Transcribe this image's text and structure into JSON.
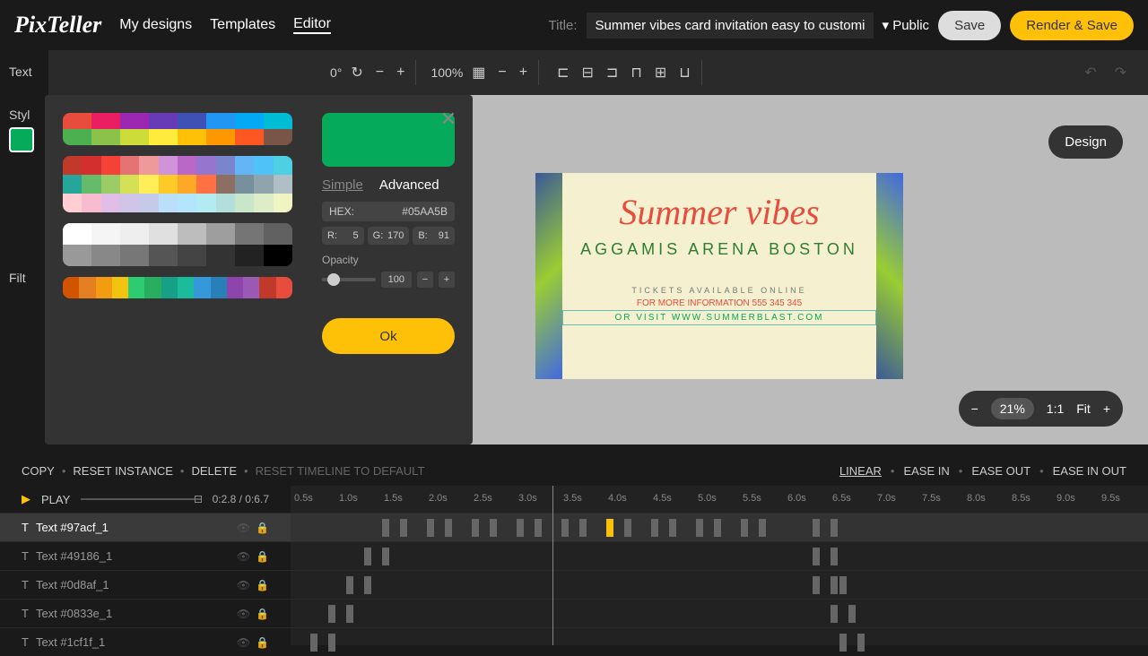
{
  "header": {
    "logo": "PixTeller",
    "nav": [
      "My designs",
      "Templates",
      "Editor"
    ],
    "title_label": "Title:",
    "title_value": "Summer vibes card invitation easy to customiz",
    "visibility": "Public",
    "save": "Save",
    "render": "Render & Save"
  },
  "toolbar": {
    "rotation": "0°",
    "zoom": "100%"
  },
  "sidebar": {
    "text_label": "Text",
    "style_label": "Styl",
    "filter_label": "Filt"
  },
  "color_picker": {
    "tabs": {
      "simple": "Simple",
      "advanced": "Advanced"
    },
    "hex_label": "HEX:",
    "hex_value": "#05AA5B",
    "r_label": "R:",
    "r_value": "5",
    "g_label": "G:",
    "g_value": "170",
    "b_label": "B:",
    "b_value": "91",
    "opacity_label": "Opacity",
    "opacity_value": "100",
    "ok": "Ok",
    "preview_color": "#05aa5b",
    "palette1": [
      [
        "#e74c3c",
        "#e91e63",
        "#9c27b0",
        "#673ab7",
        "#3f51b5",
        "#2196f3",
        "#03a9f4",
        "#00bcd4"
      ],
      [
        "#4caf50",
        "#8bc34a",
        "#cddc39",
        "#ffeb3b",
        "#ffc107",
        "#ff9800",
        "#ff5722",
        "#795548"
      ]
    ],
    "palette2": [
      [
        "#c0392b",
        "#d32f2f",
        "#f44336",
        "#e57373",
        "#ef9a9a",
        "#ce93d8",
        "#ba68c8",
        "#9575cd",
        "#7986cb",
        "#64b5f6",
        "#4fc3f7",
        "#4dd0e1"
      ],
      [
        "#26a69a",
        "#66bb6a",
        "#9ccc65",
        "#d4e157",
        "#ffee58",
        "#ffca28",
        "#ffa726",
        "#ff7043",
        "#8d6e63",
        "#78909c",
        "#90a4ae",
        "#b0bec5"
      ],
      [
        "#ffcdd2",
        "#f8bbd0",
        "#e1bee7",
        "#d1c4e9",
        "#c5cae9",
        "#bbdefb",
        "#b3e5fc",
        "#b2ebf2",
        "#b2dfdb",
        "#c8e6c9",
        "#dcedc8",
        "#f0f4c3"
      ]
    ],
    "palette3": [
      [
        "#ffffff",
        "#f5f5f5",
        "#eeeeee",
        "#e0e0e0",
        "#bdbdbd",
        "#9e9e9e",
        "#757575",
        "#616161"
      ],
      [
        "#999999",
        "#888888",
        "#777777",
        "#555555",
        "#444444",
        "#333333",
        "#222222",
        "#000000"
      ]
    ],
    "palette4": [
      [
        "#d35400",
        "#e67e22",
        "#f39c12",
        "#f1c40f",
        "#2ecc71",
        "#27ae60",
        "#16a085",
        "#1abc9c",
        "#3498db",
        "#2980b9",
        "#8e44ad",
        "#9b59b6",
        "#c0392b",
        "#e74c3c"
      ]
    ]
  },
  "canvas": {
    "title": "Summer vibes",
    "subtitle": "AGGAMIS ARENA BOSTON",
    "line1": "TICKETS AVAILABLE ONLINE",
    "line2": "FOR MORE INFORMATION 555 345 345",
    "line3": "OR VISIT WWW.SUMMERBLAST.COM",
    "design_btn": "Design"
  },
  "zoom_ctrl": {
    "value": "21%",
    "ratio": "1:1",
    "fit": "Fit"
  },
  "tl_actions": {
    "copy": "COPY",
    "reset_instance": "RESET INSTANCE",
    "delete": "DELETE",
    "reset_tl": "RESET TIMELINE TO DEFAULT",
    "linear": "LINEAR",
    "ease_in": "EASE IN",
    "ease_out": "EASE OUT",
    "ease_in_out": "EASE IN OUT"
  },
  "timeline": {
    "play": "PLAY",
    "time": "0:2.8 / 0:6.7",
    "ticks": [
      "0.5s",
      "1.0s",
      "1.5s",
      "2.0s",
      "2.5s",
      "3.0s",
      "3.5s",
      "4.0s",
      "4.5s",
      "5.0s",
      "5.5s",
      "6.0s",
      "6.5s",
      "7.0s",
      "7.5s",
      "8.0s",
      "8.5s",
      "9.0s",
      "9.5s"
    ],
    "layers": [
      "Text #97acf_1",
      "Text #49186_1",
      "Text #0d8af_1",
      "Text #0833e_1",
      "Text #1cf1f_1"
    ],
    "keyframes": [
      [
        102,
        122,
        152,
        172,
        202,
        222,
        252,
        272,
        302,
        322,
        352,
        372,
        402,
        422,
        452,
        472,
        502,
        522,
        582,
        602
      ],
      [
        82,
        102,
        582,
        602
      ],
      [
        62,
        82,
        582,
        602,
        612
      ],
      [
        42,
        62,
        602,
        622
      ],
      [
        22,
        42,
        612,
        632
      ]
    ]
  }
}
